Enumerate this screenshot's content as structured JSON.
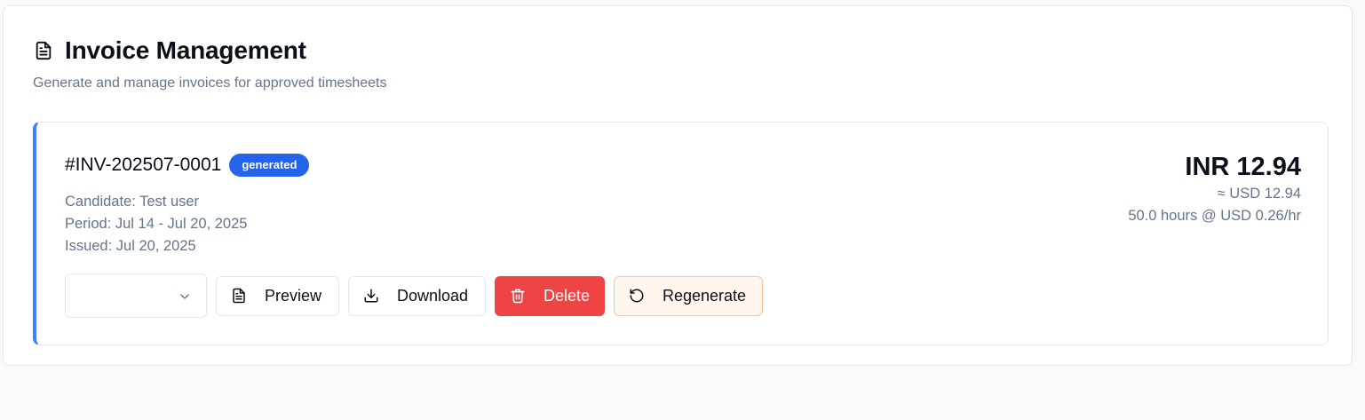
{
  "header": {
    "title": "Invoice Management",
    "subtitle": "Generate and manage invoices for approved timesheets",
    "icon": "file-text-icon"
  },
  "invoice": {
    "number": "#INV-202507-0001",
    "status": "generated",
    "candidate": "Candidate: Test user",
    "period": "Period: Jul 14 - Jul 20, 2025",
    "issued": "Issued: Jul 20, 2025",
    "amount": "INR 12.94",
    "converted": "≈ USD 12.94",
    "rate_line": "50.0 hours @ USD 0.26/hr",
    "accent_color": "#3b82f6",
    "status_color": "#2563eb"
  },
  "actions": {
    "status_select_value": "",
    "preview_label": "Preview",
    "download_label": "Download",
    "delete_label": "Delete",
    "regenerate_label": "Regenerate",
    "delete_color": "#ef4444",
    "regenerate_bg": "#fff7ed"
  }
}
